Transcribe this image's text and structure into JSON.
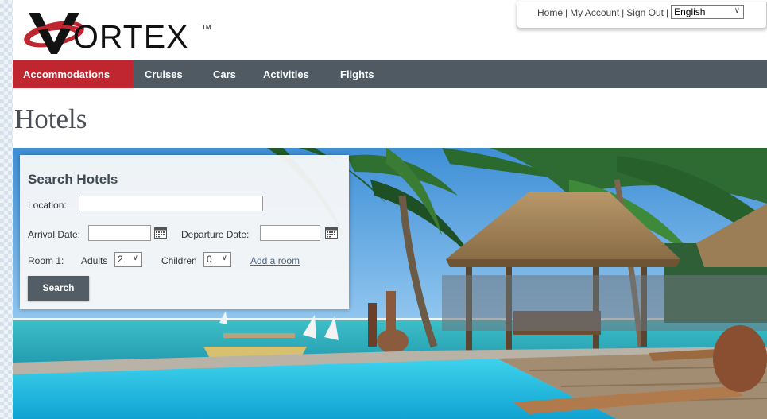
{
  "brand": {
    "logo_text": "ORTEX",
    "logo_trademark": "TM"
  },
  "utility": {
    "home": "Home",
    "my_account": "My Account",
    "sign_out": "Sign Out",
    "separator": "|",
    "language": "English"
  },
  "nav": {
    "items": [
      {
        "label": "Accommodations",
        "active": true
      },
      {
        "label": "Cruises",
        "active": false
      },
      {
        "label": "Cars",
        "active": false
      },
      {
        "label": "Activities",
        "active": false
      },
      {
        "label": "Flights",
        "active": false
      }
    ]
  },
  "page": {
    "title": "Hotels"
  },
  "search": {
    "title": "Search Hotels",
    "location_label": "Location:",
    "location_value": "",
    "arrival_label": "Arrival Date:",
    "arrival_value": "",
    "departure_label": "Departure Date:",
    "departure_value": "",
    "room_label": "Room 1:",
    "adults_label": "Adults",
    "adults_value": "2",
    "children_label": "Children",
    "children_value": "0",
    "add_room": "Add a room",
    "button": "Search"
  },
  "colors": {
    "nav_bg": "#4f5a62",
    "nav_active": "#c0262f",
    "button_bg": "#525d66",
    "logo_red": "#c0262f",
    "title_text": "#4a4f55"
  },
  "icons": [
    "calendar-icon",
    "chevron-down-icon",
    "vortex-logo-mark"
  ]
}
